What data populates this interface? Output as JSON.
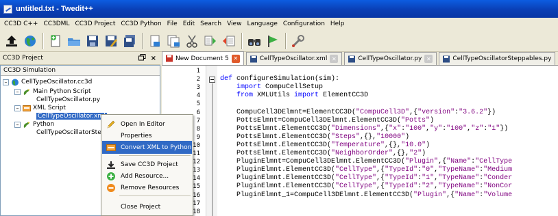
{
  "window": {
    "title": "untitled.txt - Twedit++"
  },
  "menu": [
    "CC3D C++",
    "CC3DML",
    "CC3D Project",
    "CC3D Python",
    "File",
    "Edit",
    "Search",
    "View",
    "Language",
    "Configuration",
    "Help"
  ],
  "toolbar_icons": [
    "up-arrow-icon",
    "globe-icon",
    "new-file-icon",
    "open-folder-icon",
    "save-icon",
    "save-as-icon",
    "save-all-icon",
    "close-file-icon",
    "close-all-icon",
    "cut-icon",
    "copy-icon",
    "paste-icon",
    "find-icon",
    "bookmark-icon",
    "wrench-icon"
  ],
  "left_panel": {
    "title": "CC3D Project",
    "float_label": "ร",
    "close_label": "×",
    "subheader": "CC3D Simulation",
    "tree": {
      "root": "CellTypeOscillator.cc3d",
      "main_script": "Main Python Script",
      "main_script_file": "CellTypeOscillator.py",
      "xml_script": "XML Script",
      "xml_script_file": "CellTypeOscillator.xml",
      "python": "Python",
      "python_file": "CellTypeOscillatorSteppables.py"
    }
  },
  "context_menu": {
    "items": [
      {
        "label": "Open In Editor",
        "icon": "pencil-icon"
      },
      {
        "label": "Properties",
        "icon": ""
      },
      {
        "label": "Convert XML to Python",
        "icon": "convert-icon",
        "highlighted": true
      },
      {
        "label": "Save CC3D Project",
        "icon": "download-icon"
      },
      {
        "label": "Add Resource...",
        "icon": "plus-circle-icon"
      },
      {
        "label": "Remove Resources",
        "icon": "minus-circle-icon"
      },
      {
        "label": "Close Project",
        "icon": ""
      }
    ]
  },
  "tabs": [
    {
      "label": "New Document 5",
      "active": true
    },
    {
      "label": "CellTypeOscillator.xml",
      "active": false
    },
    {
      "label": "CellTypeOscillator.py",
      "active": false
    },
    {
      "label": "CellTypeOscillatorSteppables.py",
      "active": false
    }
  ],
  "colors": {
    "accent": "#316ac5",
    "keyword": "#0000ff",
    "string": "#7f007f",
    "tab_close_active": "#e05a2b",
    "tab_close_inactive": "#c9c9c9"
  },
  "editor": {
    "line_numbers": [
      "1",
      "2",
      "3",
      "4",
      "5",
      "6",
      "7",
      "8",
      "9",
      "10",
      "11",
      "12",
      "13",
      "14",
      "15",
      "16",
      "17",
      "18"
    ],
    "lines": [
      {
        "text": ""
      },
      {
        "text": "def configureSimulation(sim):"
      },
      {
        "text": "    import CompuCellSetup"
      },
      {
        "text": "    from XMLUtils import ElementCC3D"
      },
      {
        "text": ""
      },
      {
        "text": "    CompuCell3DElmnt=ElementCC3D(\"CompuCell3D\",{\"version\":\"3.6.2\"})"
      },
      {
        "text": "    PottsElmnt=CompuCell3DElmnt.ElementCC3D(\"Potts\")"
      },
      {
        "text": "    PottsElmnt.ElementCC3D(\"Dimensions\",{\"x\":\"100\",\"y\":\"100\",\"z\":\"1\"})"
      },
      {
        "text": "    PottsElmnt.ElementCC3D(\"Steps\",{},\"10000\")"
      },
      {
        "text": "    PottsElmnt.ElementCC3D(\"Temperature\",{},\"10.0\")"
      },
      {
        "text": "    PottsElmnt.ElementCC3D(\"NeighborOrder\",{},\"2\")"
      },
      {
        "text": "    PluginElmnt=CompuCell3DElmnt.ElementCC3D(\"Plugin\",{\"Name\":\"CellType"
      },
      {
        "text": "    PluginElmnt.ElementCC3D(\"CellType\",{\"TypeId\":\"0\",\"TypeName\":\"Medium"
      },
      {
        "text": "    PluginElmnt.ElementCC3D(\"CellType\",{\"TypeId\":\"1\",\"TypeName\":\"Conder"
      },
      {
        "text": "    PluginElmnt.ElementCC3D(\"CellType\",{\"TypeId\":\"2\",\"TypeName\":\"NonCor"
      },
      {
        "text": "    PluginElmnt_1=CompuCell3DElmnt.ElementCC3D(\"Plugin\",{\"Name\":\"Volume"
      }
    ]
  }
}
